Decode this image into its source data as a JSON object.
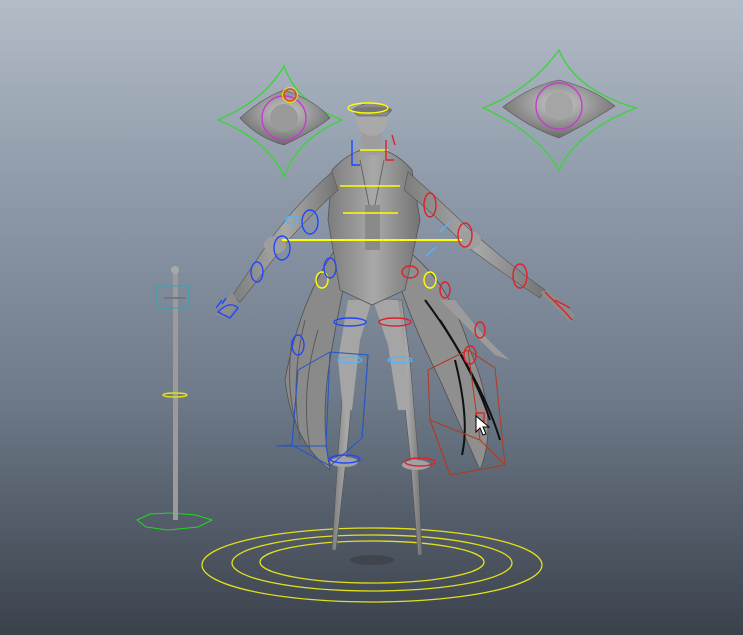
{
  "viewport": {
    "background_top": "#b3bcc7",
    "background_bottom": "#3a414b",
    "mesh_color": "#9a9a9a",
    "mesh_shadow": "#5e5e5e"
  },
  "controls": {
    "eye_control_color": "#3fd23f",
    "eye_ring_color": "#c83ad0",
    "left_side_color": "#1f46ff",
    "right_side_color": "#e0202a",
    "center_color": "#ffff00",
    "fk_color": "#4fb6ff",
    "ik_box_left_color": "#2456c8",
    "ik_box_right_color": "#b23a1e",
    "sword_control_color": "#2aa8b0",
    "ground_ring_color": "#e2e01a"
  },
  "icons": {
    "cursor": "mouse-pointer-icon"
  }
}
